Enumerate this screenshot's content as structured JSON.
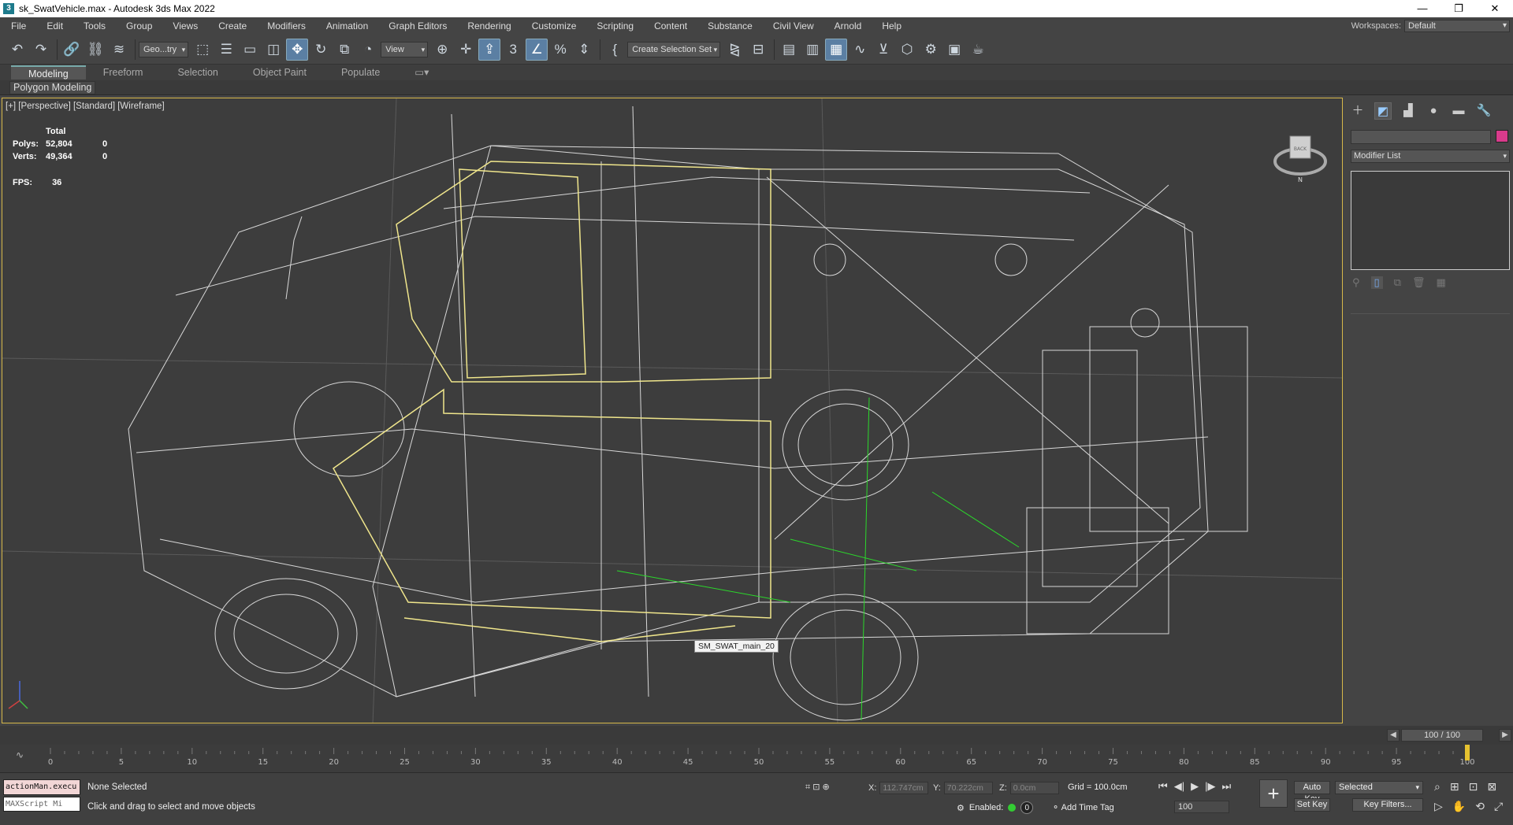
{
  "window": {
    "title": "sk_SwatVehicle.max - Autodesk 3ds Max 2022",
    "app_icon": "3"
  },
  "window_controls": {
    "minimize": "—",
    "restore": "❐",
    "close": "✕"
  },
  "menu": [
    "File",
    "Edit",
    "Tools",
    "Group",
    "Views",
    "Create",
    "Modifiers",
    "Animation",
    "Graph Editors",
    "Rendering",
    "Customize",
    "Scripting",
    "Content",
    "Substance",
    "Civil View",
    "Arnold",
    "Help"
  ],
  "workspaces": {
    "label": "Workspaces:",
    "value": "Default"
  },
  "toolbar": {
    "selection_filter": "Geo...try",
    "ref_coord": "View",
    "named_selection": "Create Selection Set"
  },
  "ribbon": {
    "tabs": [
      "Modeling",
      "Freeform",
      "Selection",
      "Object Paint",
      "Populate"
    ],
    "active_tab": "Modeling",
    "panel_label": "Polygon Modeling"
  },
  "viewport": {
    "label": "[+] [Perspective] [Standard] [Wireframe]",
    "stats": {
      "total_label": "Total",
      "polys_label": "Polys:",
      "polys_total": "52,804",
      "polys_sel": "0",
      "verts_label": "Verts:",
      "verts_total": "49,364",
      "verts_sel": "0"
    },
    "fps_label": "FPS:",
    "fps_value": "36",
    "tooltip": "SM_SWAT_main_20",
    "viewcube_face": "BACK",
    "compass_letter": "N"
  },
  "command_panel": {
    "modifier_list": "Modifier List",
    "accent_color": "#d93b8c"
  },
  "timeline": {
    "counter": "100 / 100",
    "ticks": [
      "0",
      "5",
      "10",
      "15",
      "20",
      "25",
      "30",
      "35",
      "40",
      "45",
      "50",
      "55",
      "60",
      "65",
      "70",
      "75",
      "80",
      "85",
      "90",
      "95",
      "100"
    ]
  },
  "status": {
    "maxscript_1": "actionMan.execu",
    "maxscript_2": "MAXScript Mi",
    "selection": "None Selected",
    "prompt": "Click and drag to select and move objects",
    "x_label": "X:",
    "x_value": "112.747cm",
    "y_label": "Y:",
    "y_value": "70.222cm",
    "z_label": "Z:",
    "z_value": "0.0cm",
    "grid": "Grid = 100.0cm",
    "enabled_label": "Enabled:",
    "enabled_value": "0",
    "add_time_tag": "Add Time Tag",
    "frame": "100",
    "auto_key": "Auto Key",
    "set_key": "Set Key",
    "selected": "Selected",
    "key_filters": "Key Filters..."
  }
}
